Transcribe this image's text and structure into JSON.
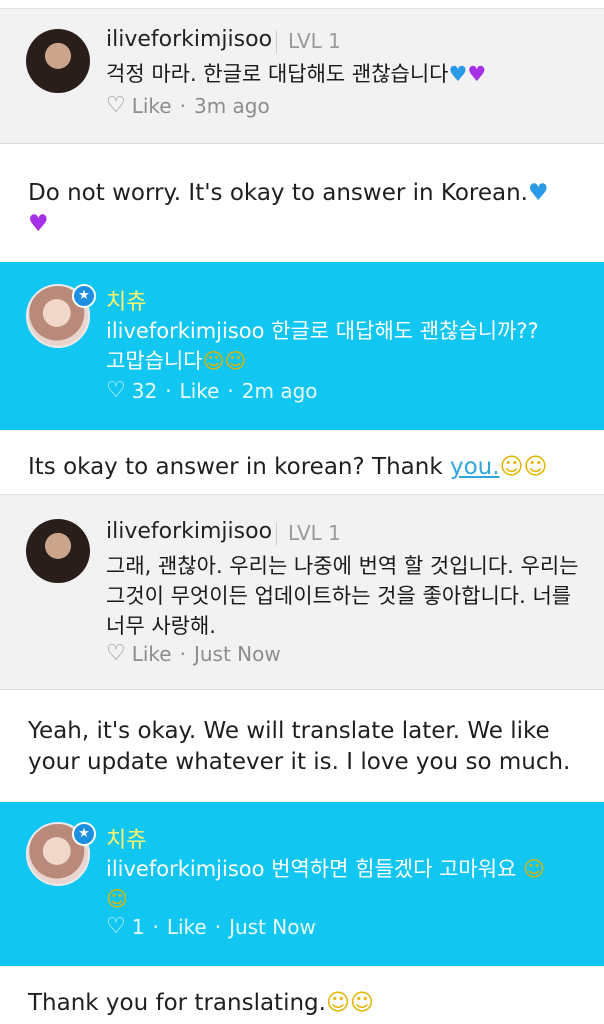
{
  "comments": [
    {
      "username": "iliveforkimjisoo",
      "level": "LVL 1",
      "text": "걱정 마라. 한글로 대답해도 괜찮습니다",
      "like": "Like",
      "time": "3m ago"
    },
    {
      "author": "치츄",
      "mention": "iliveforkimjisoo",
      "text_line1": "한글로 대답해도 괜찮습니까??",
      "text_line2": "고맙습니다",
      "likes": "32",
      "like": "Like",
      "time": "2m ago"
    },
    {
      "username": "iliveforkimjisoo",
      "level": "LVL 1",
      "text": "그래, 괜찮아. 우리는 나중에 번역 할 것입니다. 우리는 그것이 무엇이든 업데이트하는 것을 좋아합니다. 너를 너무 사랑해.",
      "like": "Like",
      "time": "Just Now"
    },
    {
      "author": "치츄",
      "mention": "iliveforkimjisoo",
      "text": "번역하면 힘들겠다 고마워요",
      "likes": "1",
      "like": "Like",
      "time": "Just Now"
    }
  ],
  "translations": {
    "t1": "Do not worry. It's okay to answer in Korean.",
    "t2_pre": "Its okay to answer in korean? Thank ",
    "t2_link": "you.",
    "t3": "Yeah, it's okay. We will translate later. We like your update whatever it is. I love you so much.",
    "t4": "Thank you for translating."
  },
  "colors": {
    "highlight_bg": "#12c6f2",
    "card_bg": "#f2f2f2",
    "accent_name": "#fff36a",
    "link": "#2fa7d8"
  },
  "icons": [
    "heart-outline-icon",
    "blue-heart-emoji",
    "purple-heart-emoji",
    "smiley-emoji",
    "star-badge-icon"
  ]
}
